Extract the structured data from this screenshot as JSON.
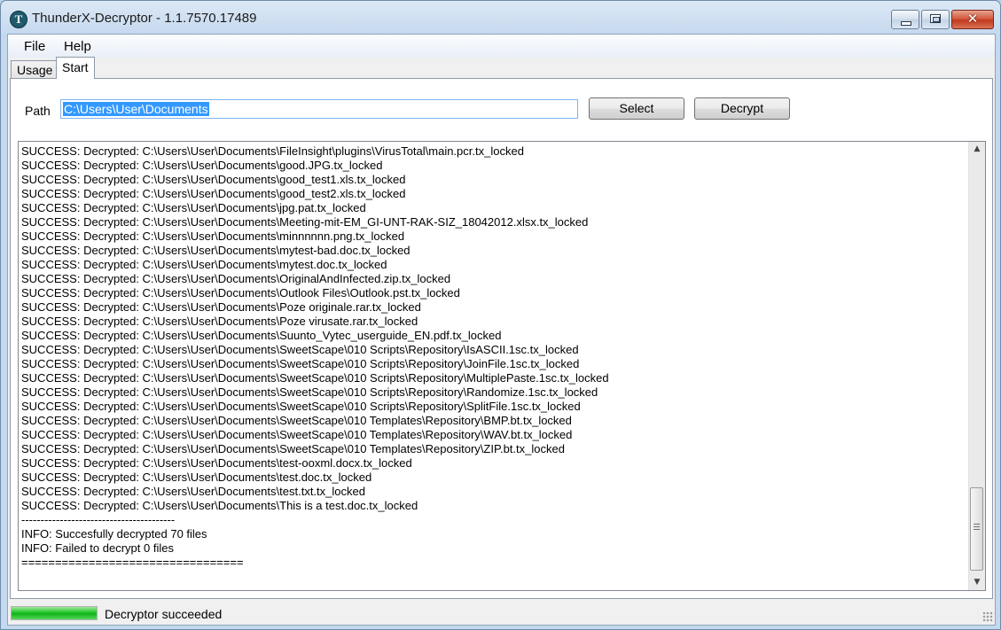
{
  "window": {
    "title": "ThunderX-Decryptor - 1.1.7570.17489",
    "icon": "shield-t-icon",
    "caption_buttons": [
      "minimize",
      "maximize",
      "close"
    ]
  },
  "menu": {
    "file_label": "File",
    "help_label": "Help"
  },
  "tabs": [
    {
      "label": "Usage",
      "active": false
    },
    {
      "label": "Start",
      "active": true
    }
  ],
  "path_section": {
    "label": "Path",
    "value": "C:\\Users\\User\\Documents"
  },
  "buttons": {
    "select_label": "Select",
    "decrypt_label": "Decrypt"
  },
  "log": {
    "lines": [
      "SUCCESS: Decrypted: C:\\Users\\User\\Documents\\FileInsight\\plugins\\VirusTotal\\main.pcr.tx_locked",
      "SUCCESS: Decrypted: C:\\Users\\User\\Documents\\good.JPG.tx_locked",
      "SUCCESS: Decrypted: C:\\Users\\User\\Documents\\good_test1.xls.tx_locked",
      "SUCCESS: Decrypted: C:\\Users\\User\\Documents\\good_test2.xls.tx_locked",
      "SUCCESS: Decrypted: C:\\Users\\User\\Documents\\jpg.pat.tx_locked",
      "SUCCESS: Decrypted: C:\\Users\\User\\Documents\\Meeting-mit-EM_GI-UNT-RAK-SIZ_18042012.xlsx.tx_locked",
      "SUCCESS: Decrypted: C:\\Users\\User\\Documents\\minnnnnn.png.tx_locked",
      "SUCCESS: Decrypted: C:\\Users\\User\\Documents\\mytest-bad.doc.tx_locked",
      "SUCCESS: Decrypted: C:\\Users\\User\\Documents\\mytest.doc.tx_locked",
      "SUCCESS: Decrypted: C:\\Users\\User\\Documents\\OriginalAndInfected.zip.tx_locked",
      "SUCCESS: Decrypted: C:\\Users\\User\\Documents\\Outlook Files\\Outlook.pst.tx_locked",
      "SUCCESS: Decrypted: C:\\Users\\User\\Documents\\Poze originale.rar.tx_locked",
      "SUCCESS: Decrypted: C:\\Users\\User\\Documents\\Poze virusate.rar.tx_locked",
      "SUCCESS: Decrypted: C:\\Users\\User\\Documents\\Suunto_Vytec_userguide_EN.pdf.tx_locked",
      "SUCCESS: Decrypted: C:\\Users\\User\\Documents\\SweetScape\\010 Scripts\\Repository\\IsASCII.1sc.tx_locked",
      "SUCCESS: Decrypted: C:\\Users\\User\\Documents\\SweetScape\\010 Scripts\\Repository\\JoinFile.1sc.tx_locked",
      "SUCCESS: Decrypted: C:\\Users\\User\\Documents\\SweetScape\\010 Scripts\\Repository\\MultiplePaste.1sc.tx_locked",
      "SUCCESS: Decrypted: C:\\Users\\User\\Documents\\SweetScape\\010 Scripts\\Repository\\Randomize.1sc.tx_locked",
      "SUCCESS: Decrypted: C:\\Users\\User\\Documents\\SweetScape\\010 Scripts\\Repository\\SplitFile.1sc.tx_locked",
      "SUCCESS: Decrypted: C:\\Users\\User\\Documents\\SweetScape\\010 Templates\\Repository\\BMP.bt.tx_locked",
      "SUCCESS: Decrypted: C:\\Users\\User\\Documents\\SweetScape\\010 Templates\\Repository\\WAV.bt.tx_locked",
      "SUCCESS: Decrypted: C:\\Users\\User\\Documents\\SweetScape\\010 Templates\\Repository\\ZIP.bt.tx_locked",
      "SUCCESS: Decrypted: C:\\Users\\User\\Documents\\test-ooxml.docx.tx_locked",
      "SUCCESS: Decrypted: C:\\Users\\User\\Documents\\test.doc.tx_locked",
      "SUCCESS: Decrypted: C:\\Users\\User\\Documents\\test.txt.tx_locked",
      "SUCCESS: Decrypted: C:\\Users\\User\\Documents\\This is a test.doc.tx_locked",
      "----------------------------------------",
      "INFO: Succesfully decrypted 70 files",
      "INFO: Failed to decrypt 0 files",
      "================================="
    ]
  },
  "status": {
    "progress_fraction": 1.0,
    "progress_color": "#1fbf26",
    "text": "Decryptor succeeded"
  }
}
